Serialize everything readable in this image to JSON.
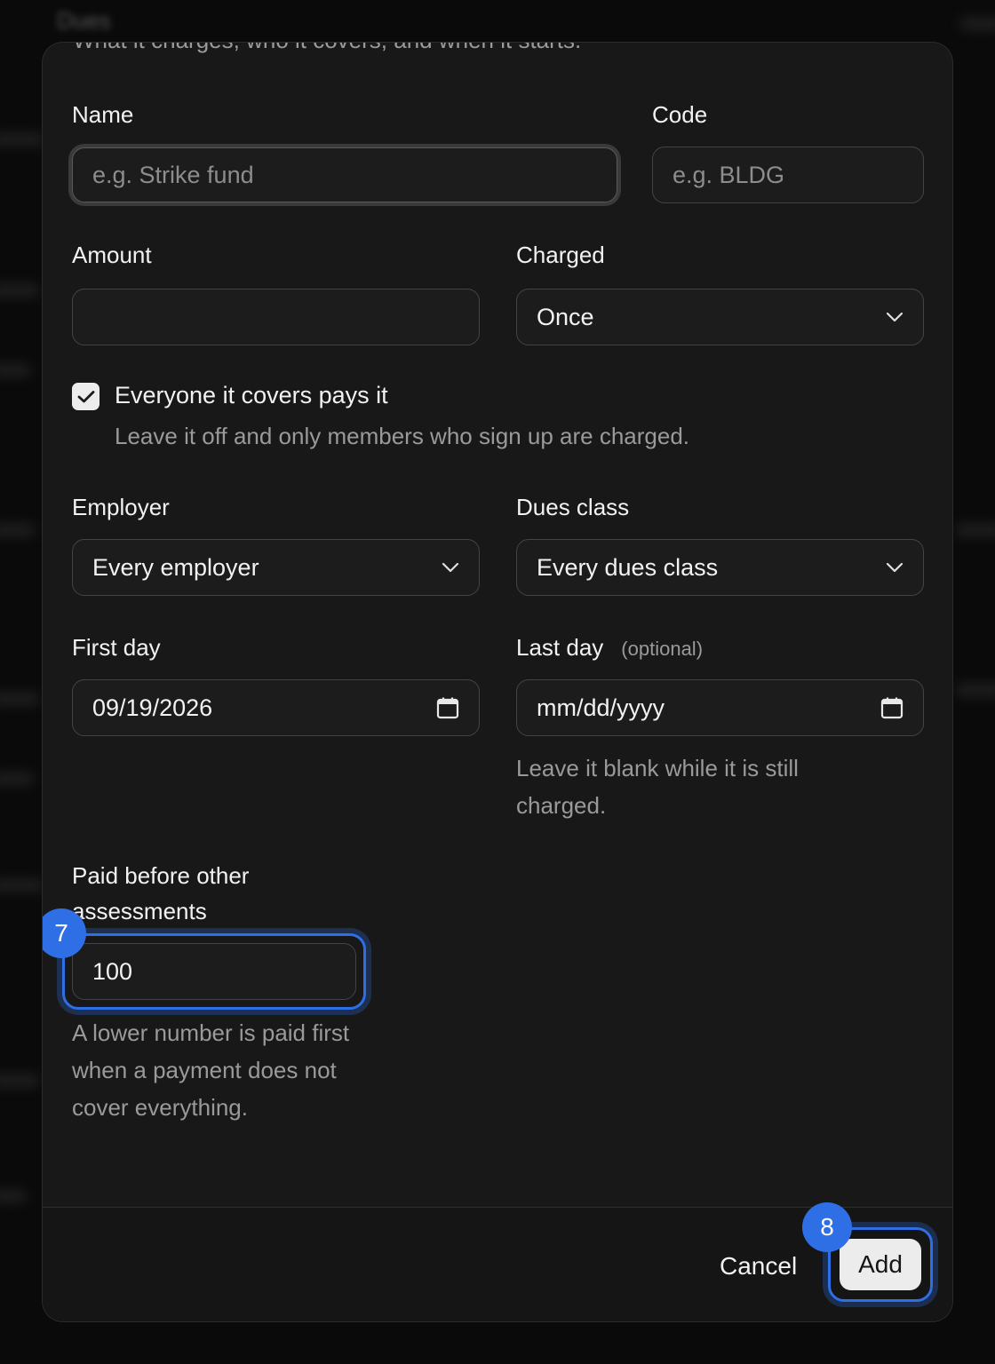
{
  "background": {
    "title": "Dues"
  },
  "dialog": {
    "subtitle": "What it charges, who it covers, and when it starts.",
    "name": {
      "label": "Name",
      "placeholder": "e.g. Strike fund",
      "value": ""
    },
    "code": {
      "label": "Code",
      "placeholder": "e.g. BLDG",
      "value": ""
    },
    "amount": {
      "label": "Amount",
      "value": ""
    },
    "charged": {
      "label": "Charged",
      "selected": "Once"
    },
    "everyone": {
      "label": "Everyone it covers pays it",
      "checked": true,
      "help": "Leave it off and only members who sign up are charged."
    },
    "employer": {
      "label": "Employer",
      "selected": "Every employer"
    },
    "dues_class": {
      "label": "Dues class",
      "selected": "Every dues class"
    },
    "first_day": {
      "label": "First day",
      "value": "09/19/2026"
    },
    "last_day": {
      "label": "Last day",
      "optional": "(optional)",
      "value": "mm/dd/yyyy",
      "help": "Leave it blank while it is still charged."
    },
    "priority": {
      "label": "Paid before other assessments",
      "value": "100",
      "help": "A lower number is paid first when a payment does not cover everything."
    },
    "footer": {
      "cancel_label": "Cancel",
      "add_label": "Add"
    }
  },
  "annotations": [
    {
      "id": "7",
      "target": "priority-input"
    },
    {
      "id": "8",
      "target": "add-button"
    }
  ],
  "colors": {
    "highlight": "#2f6fe6",
    "panel": "#181818",
    "field_border": "#444444",
    "button_bg": "#ececec"
  }
}
